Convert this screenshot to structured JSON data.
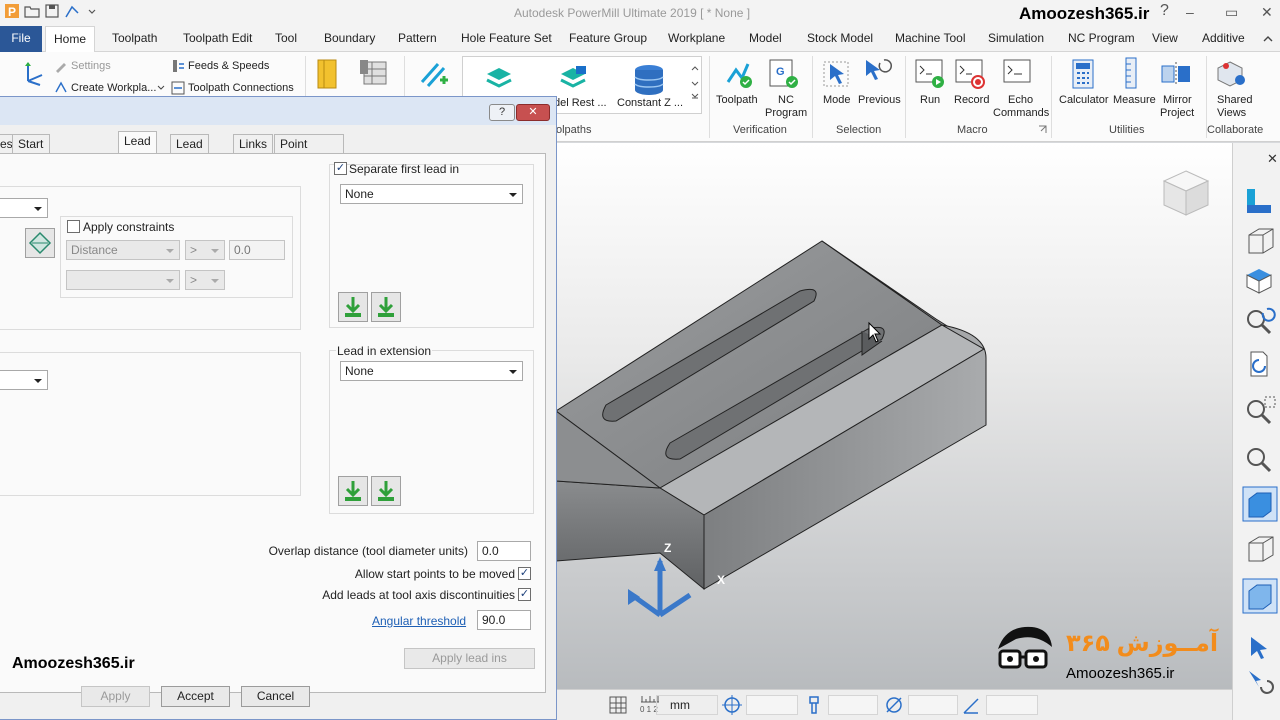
{
  "window": {
    "title": "Autodesk PowerMill Ultimate 2019   [ * None ]",
    "brand": "Amoozesh365.ir",
    "help_glyph": "?",
    "minimize_glyph": "–",
    "restore_glyph": "▭",
    "close_glyph": "✕"
  },
  "ribbon_tabs": [
    "File",
    "Home",
    "Toolpath",
    "Toolpath Edit",
    "Tool",
    "Boundary",
    "Pattern",
    "Hole Feature Set",
    "Feature Group",
    "Workplane",
    "Model",
    "Stock Model",
    "Machine Tool",
    "Simulation",
    "NC Program",
    "View",
    "Additive"
  ],
  "ribbon": {
    "settings_label": "Settings",
    "create_workplane_label": "Create Workpla...",
    "feeds_speeds_label": "Feeds & Speeds",
    "toolpath_connections_label": "Toolpath Connections",
    "model_rest_label": "del Rest ...",
    "constant_z_label": "Constant Z ...",
    "toolpaths_group": "olpaths",
    "toolpath_btn": "Toolpath",
    "nc_program_btn_1": "NC",
    "nc_program_btn_2": "Program",
    "verification_group": "Verification",
    "mode_btn": "Mode",
    "previous_btn": "Previous",
    "selection_group": "Selection",
    "run_btn": "Run",
    "record_btn": "Record",
    "echo_btn_1": "Echo",
    "echo_btn_2": "Commands",
    "macro_group": "Macro",
    "calculator_btn": "Calculator",
    "measure_btn": "Measure",
    "mirror_btn_1": "Mirror",
    "mirror_btn_2": "Project",
    "utilities_group": "Utilities",
    "shared_btn_1": "Shared",
    "shared_btn_2": "Views",
    "collaborate_group": "Collaborate"
  },
  "dialog": {
    "help": "?",
    "close": "✕",
    "tabs": [
      "es",
      "Start and end point",
      "Lead ins",
      "Lead outs",
      "Links",
      "Point distribution"
    ],
    "active_tab": "Lead ins",
    "apply_constraints_label": "Apply constraints",
    "apply_constraints_checked": false,
    "constraint_type": "Distance",
    "constraint_compare": ">",
    "constraint_compare_2": ">",
    "constraint_value": "0.0",
    "separate_first_lead_label": "Separate first lead in",
    "separate_first_lead_checked": true,
    "separate_first_lead_value": "None",
    "lead_in_extension_label": "Lead in extension",
    "lead_in_extension_value": "None",
    "overlap_label": "Overlap distance (tool diameter units)",
    "overlap_value": "0.0",
    "allow_start_label": "Allow start points to be moved",
    "allow_start_checked": true,
    "add_leads_label": "Add leads at tool axis discontinuities",
    "add_leads_checked": true,
    "angular_threshold_label": "Angular threshold",
    "angular_threshold_value": "90.0",
    "apply_leads_btn": "Apply lead ins",
    "apply_btn": "Apply",
    "accept_btn": "Accept",
    "cancel_btn": "Cancel",
    "check_mark": "✓"
  },
  "viewport": {
    "axis_z": "Z",
    "axis_x": "X",
    "watermark_left": "Amoozesh365.ir",
    "watermark_logo_text": "Amoozesh365.ir",
    "logo_persian": "آمــوزش ۳۶۵"
  },
  "statusbar": {
    "units": "mm",
    "ruler_digits": "0 1 2"
  },
  "colors": {
    "file_tab": "#2b5797",
    "dialog_title": "#dce6f4",
    "close_button": "#c75050",
    "axis_blue": "#3a78c9",
    "logo_orange": "#f28c1c"
  }
}
